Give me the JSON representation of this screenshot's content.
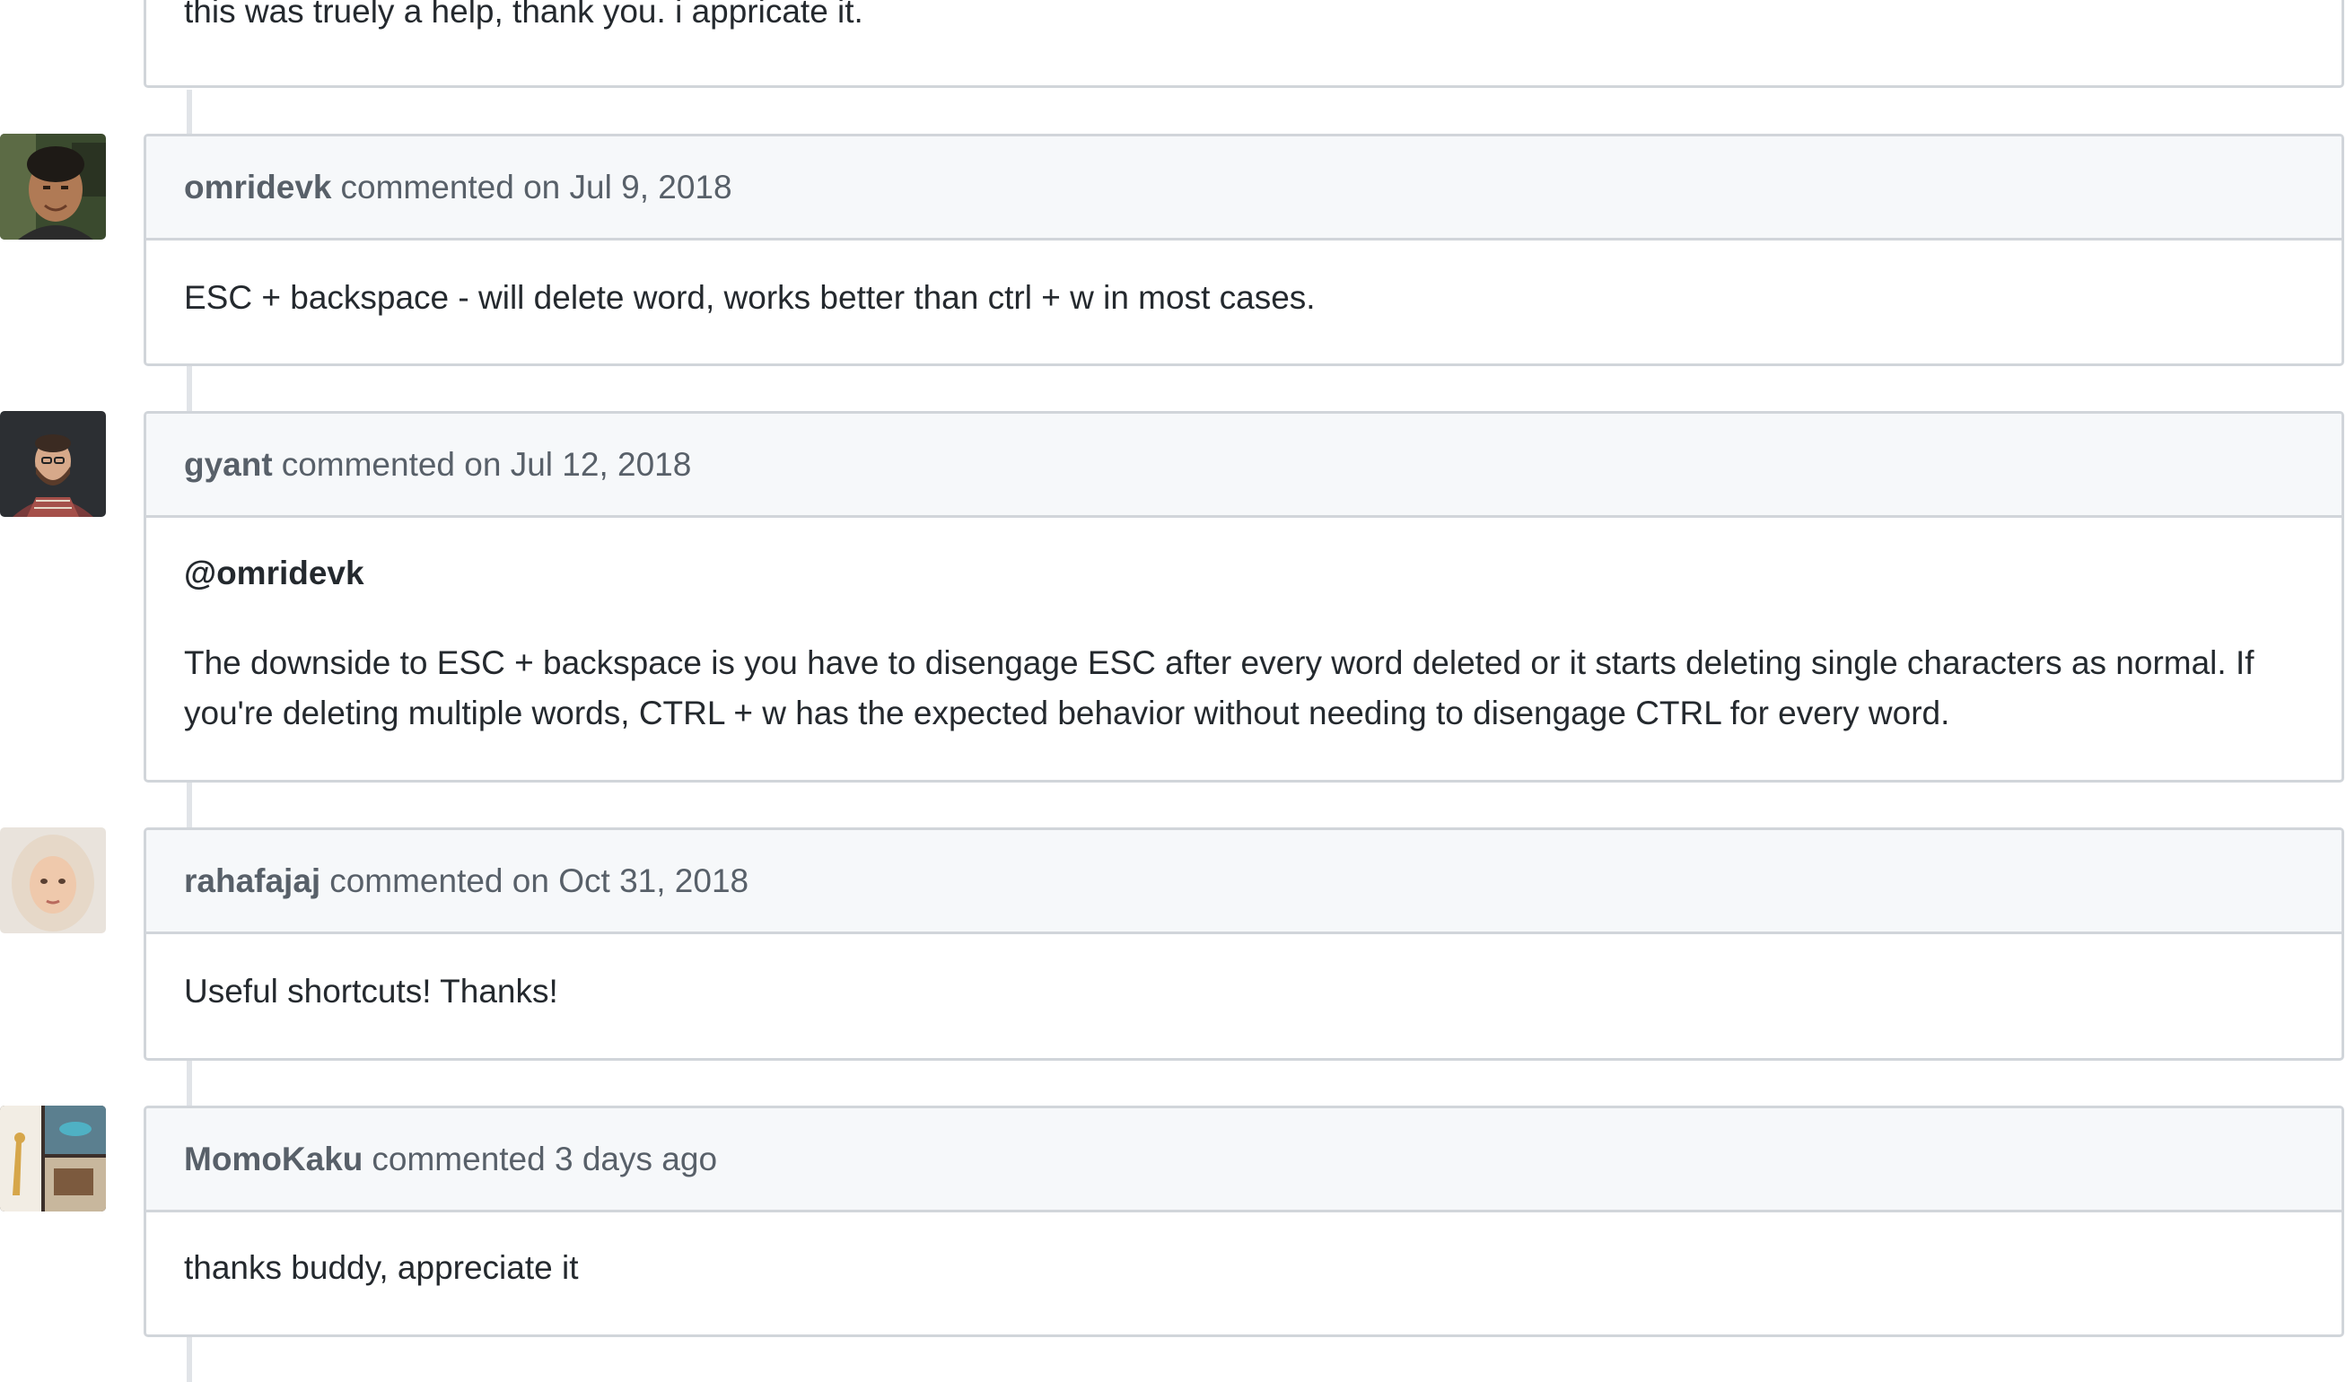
{
  "comments": [
    {
      "body": "this was truely a help, thank you. i appricate it."
    },
    {
      "author": "omridevk",
      "meta": "commented on Jul 9, 2018",
      "body": "ESC + backspace - will delete word, works better than ctrl + w in most cases."
    },
    {
      "author": "gyant",
      "meta": "commented on Jul 12, 2018",
      "mention": "@omridevk",
      "body": "The downside to ESC + backspace is you have to disengage ESC after every word deleted or it starts deleting single characters as normal. If you're deleting multiple words, CTRL + w has the expected behavior without needing to disengage CTRL for every word."
    },
    {
      "author": "rahafajaj",
      "meta": "commented on Oct 31, 2018",
      "body": "Useful shortcuts! Thanks!"
    },
    {
      "author": "MomoKaku",
      "meta": "commented 3 days ago",
      "body": "thanks buddy, appreciate it"
    }
  ],
  "colors": {
    "header_bg": "#f6f8fa",
    "border": "#d1d5da",
    "meta_text": "#586069",
    "body_text": "#24292e",
    "rail": "#e1e4e8"
  }
}
